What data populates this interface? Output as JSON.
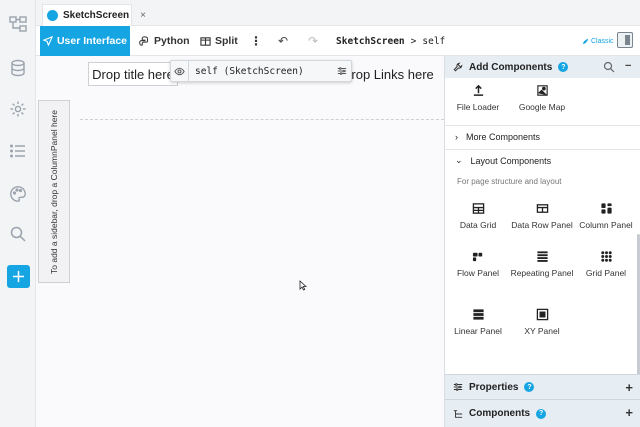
{
  "tab": {
    "title": "SketchScreen",
    "close": "×"
  },
  "toolbar": {
    "ui_label": "User Interface",
    "python_label": "Python",
    "split_label": "Split",
    "more": "⋮",
    "undo": "↶",
    "redo": "↷",
    "breadcrumb_form": "SketchScreen",
    "breadcrumb_sep": ">",
    "breadcrumb_self": "self",
    "classic_label": "Classic"
  },
  "canvas": {
    "drop_title": "Drop title here",
    "drop_links": "Drop Links here",
    "self_label": "self (SketchScreen)",
    "sidebar_hint": "To add a sidebar, drop a ColumnPanel here"
  },
  "panel": {
    "header": "Add Components",
    "help": "?",
    "collapse": "−",
    "components_top": [
      "File Loader",
      "Google Map"
    ],
    "more_components": "More Components",
    "layout_components": "Layout Components",
    "layout_sub": "For page structure and layout",
    "layout_items": [
      "Data Grid",
      "Data Row Panel",
      "Column Panel",
      "Flow Panel",
      "Repeating Panel",
      "Grid Panel",
      "Linear Panel",
      "XY Panel"
    ],
    "properties": "Properties",
    "components": "Components",
    "expand": "+"
  },
  "icons": {
    "rail": [
      "app-tree-icon",
      "database-icon",
      "settings-icon",
      "list-icon",
      "palette-icon",
      "search-icon",
      "add-icon"
    ]
  },
  "colors": {
    "accent": "#16a5e3",
    "panel_header": "#e6edf3"
  }
}
